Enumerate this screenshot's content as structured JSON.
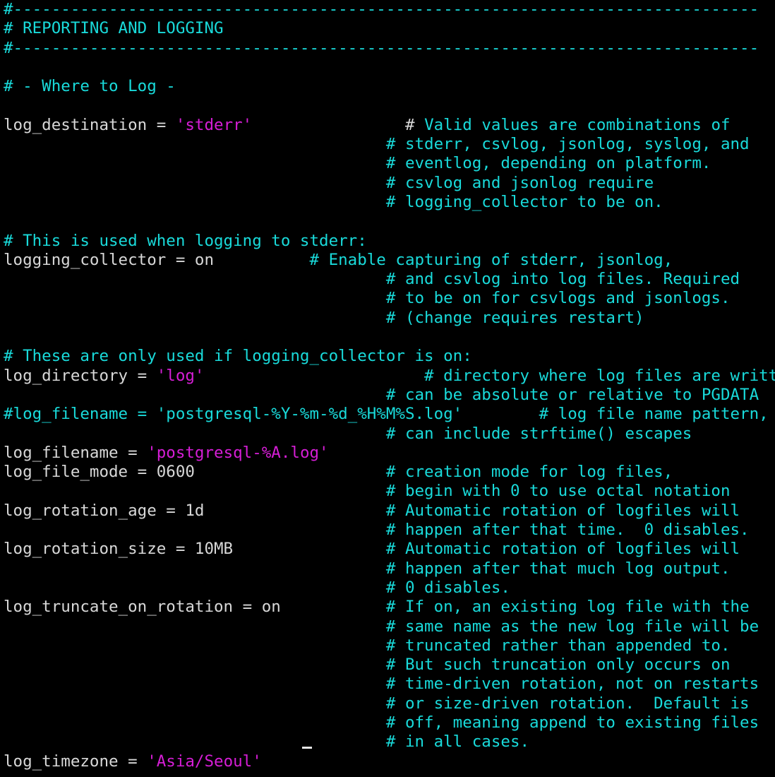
{
  "colors": {
    "background": "#000000",
    "comment": "#19dada",
    "string": "#d61ed6",
    "text": "#d8d8d8"
  },
  "lines": [
    [
      {
        "t": "#------------------------------------------------------------------------------",
        "c": "comment"
      }
    ],
    [
      {
        "t": "# REPORTING AND LOGGING",
        "c": "comment"
      }
    ],
    [
      {
        "t": "#------------------------------------------------------------------------------",
        "c": "comment"
      }
    ],
    [],
    [
      {
        "t": "# - Where to Log -",
        "c": "comment"
      }
    ],
    [],
    [
      {
        "t": "log_destination = ",
        "c": "text"
      },
      {
        "t": "'stderr'",
        "c": "string"
      },
      {
        "t": "                # ",
        "c": "text"
      },
      {
        "t": "Valid values are combinations of",
        "c": "comment"
      }
    ],
    [
      {
        "t": "                                        # stderr, csvlog, jsonlog, syslog, and",
        "c": "comment"
      }
    ],
    [
      {
        "t": "                                        # eventlog, depending on platform.",
        "c": "comment"
      }
    ],
    [
      {
        "t": "                                        # csvlog and jsonlog require",
        "c": "comment"
      }
    ],
    [
      {
        "t": "                                        # logging_collector to be on.",
        "c": "comment"
      }
    ],
    [],
    [
      {
        "t": "# This is used when logging to stderr:",
        "c": "comment"
      }
    ],
    [
      {
        "t": "logging_collector = on          ",
        "c": "text"
      },
      {
        "t": "# Enable capturing of stderr, jsonlog,",
        "c": "comment"
      }
    ],
    [
      {
        "t": "                                        # and csvlog into log files. Required",
        "c": "comment"
      }
    ],
    [
      {
        "t": "                                        # to be on for csvlogs and jsonlogs.",
        "c": "comment"
      }
    ],
    [
      {
        "t": "                                        # (change requires restart)",
        "c": "comment"
      }
    ],
    [],
    [
      {
        "t": "# These are only used if logging_collector is on:",
        "c": "comment"
      }
    ],
    [
      {
        "t": "log_directory = ",
        "c": "text"
      },
      {
        "t": "'log'",
        "c": "string"
      },
      {
        "t": "                       ",
        "c": "text"
      },
      {
        "t": "# directory where log files are written,",
        "c": "comment"
      }
    ],
    [
      {
        "t": "                                        # can be absolute or relative to PGDATA",
        "c": "comment"
      }
    ],
    [
      {
        "t": "#log_filename = 'postgresql-%Y-%m-%d_%H%M%S.log'        # log file name pattern,",
        "c": "comment"
      }
    ],
    [
      {
        "t": "                                        # can include strftime() escapes",
        "c": "comment"
      }
    ],
    [
      {
        "t": "log_filename = ",
        "c": "text"
      },
      {
        "t": "'postgresql-%A.log'",
        "c": "string"
      }
    ],
    [
      {
        "t": "log_file_mode = 0600                    ",
        "c": "text"
      },
      {
        "t": "# creation mode for log files,",
        "c": "comment"
      }
    ],
    [
      {
        "t": "                                        # begin with 0 to use octal notation",
        "c": "comment"
      }
    ],
    [
      {
        "t": "log_rotation_age = 1d                   ",
        "c": "text"
      },
      {
        "t": "# Automatic rotation of logfiles will",
        "c": "comment"
      }
    ],
    [
      {
        "t": "                                        # happen after that time.  0 disables.",
        "c": "comment"
      }
    ],
    [
      {
        "t": "log_rotation_size = 10MB                ",
        "c": "text"
      },
      {
        "t": "# Automatic rotation of logfiles will",
        "c": "comment"
      }
    ],
    [
      {
        "t": "                                        # happen after that much log output.",
        "c": "comment"
      }
    ],
    [
      {
        "t": "                                        # 0 disables.",
        "c": "comment"
      }
    ],
    [
      {
        "t": "log_truncate_on_rotation = on           ",
        "c": "text"
      },
      {
        "t": "# If on, an existing log file with the",
        "c": "comment"
      }
    ],
    [
      {
        "t": "                                        # same name as the new log file will be",
        "c": "comment"
      }
    ],
    [
      {
        "t": "                                        # truncated rather than appended to.",
        "c": "comment"
      }
    ],
    [
      {
        "t": "                                        # But such truncation only occurs on",
        "c": "comment"
      }
    ],
    [
      {
        "t": "                                        # time-driven rotation, not on restarts",
        "c": "comment"
      }
    ],
    [
      {
        "t": "                                        # or size-driven rotation.  Default is",
        "c": "comment"
      }
    ],
    [
      {
        "t": "                                        # off, meaning append to existing files",
        "c": "comment"
      }
    ],
    [
      {
        "t": "                                        # in all cases.",
        "c": "comment"
      }
    ],
    [
      {
        "t": "log_timezone = ",
        "c": "text"
      },
      {
        "t": "'Asia/Seoul'",
        "c": "string"
      }
    ]
  ]
}
